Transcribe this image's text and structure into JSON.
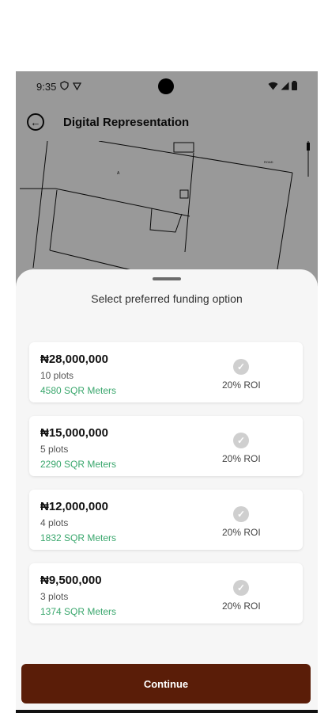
{
  "status_bar": {
    "time": "9:35"
  },
  "app_bar": {
    "title": "Digital Representation"
  },
  "sheet": {
    "title": "Select preferred funding option",
    "options": [
      {
        "price": "₦28,000,000",
        "plots": "10 plots",
        "area": "4580 SQR Meters",
        "roi": "20% ROI"
      },
      {
        "price": "₦15,000,000",
        "plots": "5 plots",
        "area": "2290 SQR Meters",
        "roi": "20% ROI"
      },
      {
        "price": "₦12,000,000",
        "plots": "4 plots",
        "area": "1832 SQR Meters",
        "roi": "20% ROI"
      },
      {
        "price": "₦9,500,000",
        "plots": "3 plots",
        "area": "1374 SQR Meters",
        "roi": "20% ROI"
      }
    ],
    "continue_label": "Continue"
  },
  "colors": {
    "accent": "#5a1d08",
    "area_text": "#3aa76d"
  }
}
